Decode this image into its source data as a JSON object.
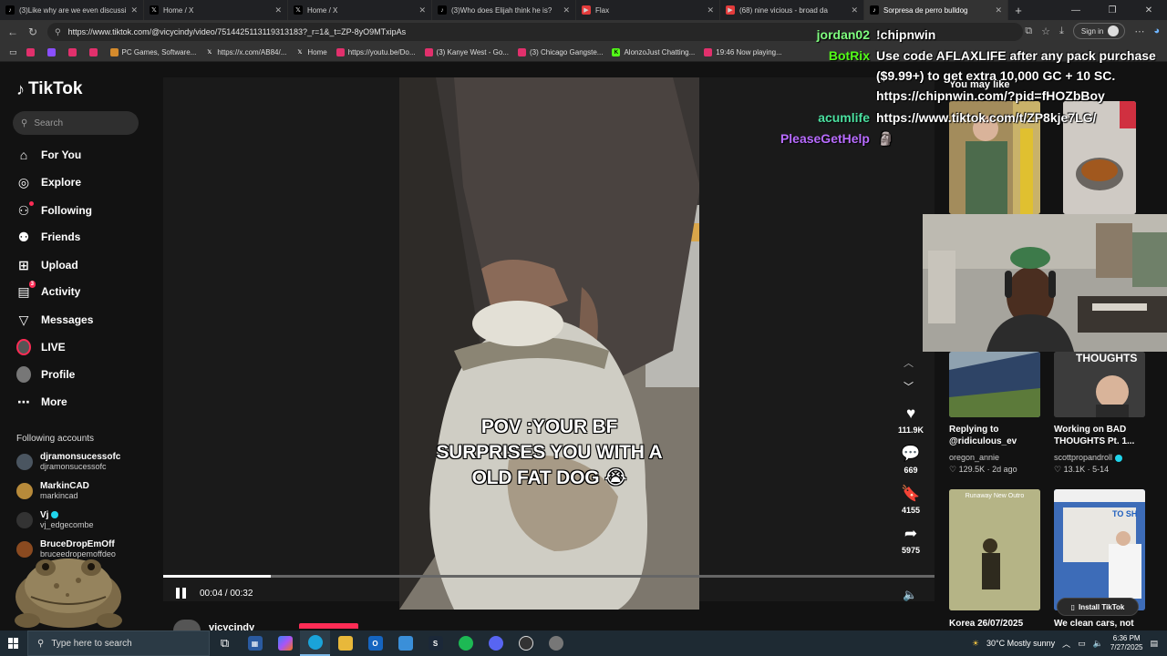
{
  "browser": {
    "tabs": [
      {
        "label": "(3)Like why are we even discussi",
        "icon": "tiktok-icon",
        "color": "#000000"
      },
      {
        "label": "Home / X",
        "icon": "x-icon",
        "color": "#000000"
      },
      {
        "label": "Home / X",
        "icon": "x-icon",
        "color": "#000000"
      },
      {
        "label": "(3)Who does Elijah think he is?",
        "icon": "tiktok-icon",
        "color": "#000000"
      },
      {
        "label": "Flax",
        "icon": "youtube-icon",
        "color": "#e33b3b"
      },
      {
        "label": "(68) nine vicious - broad da",
        "icon": "youtube-icon",
        "color": "#e33b3b"
      },
      {
        "label": "Sorpresa de perro bulldog",
        "icon": "tiktok-icon",
        "color": "#000000"
      }
    ],
    "url": "https://www.tiktok.com/@vicycindy/video/7514425113119313183?_r=1&_t=ZP-8yO9MTxipAs",
    "signin_label": "Sign in",
    "bookmarks": [
      {
        "label": "",
        "color": "#e1306c"
      },
      {
        "label": "",
        "color": "#8a4fff"
      },
      {
        "label": "",
        "color": "#e1306c"
      },
      {
        "label": "",
        "color": "#e1306c"
      },
      {
        "label": "PC Games, Software...",
        "color": "#d48a2c"
      },
      {
        "label": "https://x.com/AB84/...",
        "color": "#000000"
      },
      {
        "label": "Home",
        "color": "#000000"
      },
      {
        "label": "https://youtu.be/Do...",
        "color": "#e1306c"
      },
      {
        "label": "(3) Kanye West - Go...",
        "color": "#e1306c"
      },
      {
        "label": "(3) Chicago Gangste...",
        "color": "#e1306c"
      },
      {
        "label": "AlonzoJust Chatting...",
        "color": "#53fc18"
      },
      {
        "label": "19:46 Now playing...",
        "color": "#e1306c"
      }
    ]
  },
  "tiktok": {
    "logo": "TikTok",
    "search_placeholder": "Search",
    "nav": [
      {
        "label": "For You",
        "icon": "home-icon"
      },
      {
        "label": "Explore",
        "icon": "compass-icon"
      },
      {
        "label": "Following",
        "icon": "following-icon"
      },
      {
        "label": "Friends",
        "icon": "friends-icon"
      },
      {
        "label": "Upload",
        "icon": "upload-icon"
      },
      {
        "label": "Activity",
        "icon": "activity-icon",
        "badge": "3"
      },
      {
        "label": "Messages",
        "icon": "messages-icon"
      },
      {
        "label": "LIVE",
        "icon": "live-icon"
      },
      {
        "label": "Profile",
        "icon": "profile-icon"
      },
      {
        "label": "More",
        "icon": "more-icon"
      }
    ],
    "following_title": "Following accounts",
    "following": [
      {
        "name": "djramonsucessofc",
        "user": "djramonsucessofc"
      },
      {
        "name": "MarkinCAD",
        "user": "markincad"
      },
      {
        "name": "Vj",
        "user": "vj_edgecombe"
      },
      {
        "name": "BruceDropEmOff",
        "user": "bruceedropemoffdeo"
      }
    ],
    "video": {
      "caption_lines": [
        "POV :YOUR BF",
        "SURPRISES YOU WITH A",
        "OLD FAT DOG 😭"
      ],
      "time": "00:04 / 00:32",
      "progress": 0.14,
      "likes": "111.9K",
      "comments": "669",
      "saves": "4155",
      "shares": "5975",
      "author": "vicycindy"
    },
    "you_may_like": "You may like",
    "recommended": [
      {
        "title": "",
        "user": "",
        "stat": ""
      },
      {
        "title": "",
        "user": "",
        "stat": ""
      },
      {
        "title": "Replying to @ridiculous_ev",
        "user": "oregon_annie",
        "stat": "♡ 129.5K · 2d ago",
        "thumb_text": ""
      },
      {
        "title": "Working on BAD THOUGHTS Pt. 1...",
        "user": "scottpropandroll",
        "stat": "♡ 13.1K · 5-14",
        "thumb_text": "THOUGHTS"
      },
      {
        "title": "Korea 26/07/2025",
        "user": "",
        "stat": "",
        "thumb_text": "Runaway New Outro"
      },
      {
        "title": "We clean cars, not",
        "user": "",
        "stat": "",
        "thumb_text": "TO SH"
      }
    ],
    "install_label": "Install TikTok"
  },
  "chat": [
    {
      "user": "jordan02",
      "color": "#7fff7f",
      "message": "!chipnwin"
    },
    {
      "user": "BotRix",
      "color": "#53fc18",
      "message": "Use code AFLAXLIFE after any pack purchase"
    },
    {
      "user": "",
      "color": "#ffffff",
      "message": "($9.99+) to get extra 10,000 GC + 10 SC."
    },
    {
      "user": "",
      "color": "#ffffff",
      "message": "https://chipnwin.com/?pid=fHOZbBoy"
    },
    {
      "user": "acumlife",
      "color": "#4be0a0",
      "message": "https://www.tiktok.com/t/ZP8kje7LG/"
    },
    {
      "user": "PleaseGetHelp",
      "color": "#b86cff",
      "message": "🗿"
    }
  ],
  "taskbar": {
    "search_placeholder": "Type here to search",
    "weather": "30°C  Mostly sunny",
    "time": "6:36 PM",
    "date": "7/27/2025"
  },
  "colors": {
    "accent": "#fe2c55",
    "verified": "#20d5ec"
  }
}
